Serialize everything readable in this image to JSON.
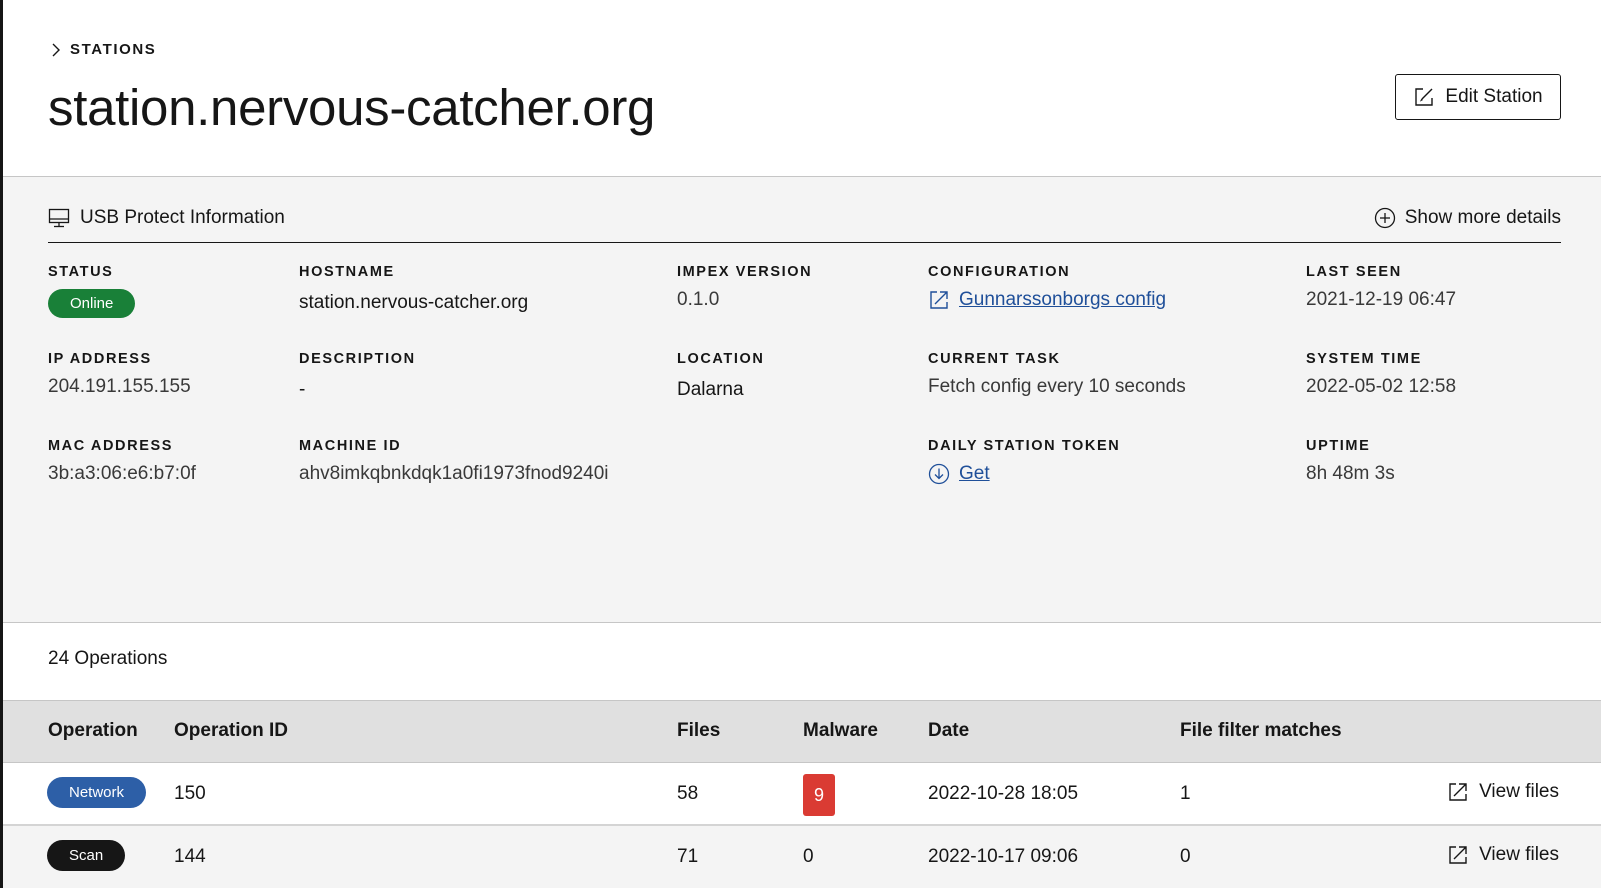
{
  "breadcrumb": {
    "label": "STATIONS"
  },
  "page": {
    "title": "station.nervous-catcher.org"
  },
  "header": {
    "edit_label": "Edit Station"
  },
  "info": {
    "title": "USB Protect Information",
    "more_label": "Show more details",
    "status": {
      "label": "STATUS",
      "value": "Online",
      "color": "#198038"
    },
    "hostname": {
      "label": "HOSTNAME",
      "value": "station.nervous-catcher.org"
    },
    "impex_version": {
      "label": "IMPEX VERSION",
      "value": "0.1.0"
    },
    "configuration": {
      "label": "CONFIGURATION",
      "value": "Gunnarssonborgs config"
    },
    "last_seen": {
      "label": "LAST SEEN",
      "value": "2021-12-19 06:47"
    },
    "ip_address": {
      "label": "IP ADDRESS",
      "value": "204.191.155.155"
    },
    "description": {
      "label": "DESCRIPTION",
      "value": "-"
    },
    "location": {
      "label": "LOCATION",
      "value": "Dalarna"
    },
    "current_task": {
      "label": "CURRENT TASK",
      "value": "Fetch config every 10 seconds"
    },
    "system_time": {
      "label": "SYSTEM TIME",
      "value": "2022-05-02 12:58"
    },
    "mac_address": {
      "label": "MAC ADDRESS",
      "value": "3b:a3:06:e6:b7:0f"
    },
    "machine_id": {
      "label": "MACHINE ID",
      "value": "ahv8imkqbnkdqk1a0fi1973fnod9240i"
    },
    "daily_token": {
      "label": "DAILY STATION TOKEN",
      "value": "Get"
    },
    "uptime": {
      "label": "UPTIME",
      "value": "8h 48m 3s"
    }
  },
  "operations": {
    "count_label": "24 Operations",
    "columns": [
      "Operation",
      "Operation ID",
      "Files",
      "Malware",
      "Date",
      "File filter matches"
    ],
    "rows": [
      {
        "operation": "Network",
        "operation_color": "#2d5fa7",
        "id": "150",
        "files": "58",
        "malware": "9",
        "malware_color": "#da3b33",
        "date": "2022-10-28 18:05",
        "filter_matches": "1",
        "action": "View files"
      },
      {
        "operation": "Scan",
        "operation_color": "#161616",
        "id": "144",
        "files": "71",
        "malware": "0",
        "date": "2022-10-17 09:06",
        "filter_matches": "0",
        "action": "View files"
      }
    ]
  },
  "icons": {
    "breadcrumb": "chevron-right-icon",
    "edit": "edit-icon",
    "info": "monitor-icon",
    "more": "add-circle-icon",
    "config": "launch-icon",
    "token": "download-circle-icon",
    "view": "launch-icon"
  }
}
